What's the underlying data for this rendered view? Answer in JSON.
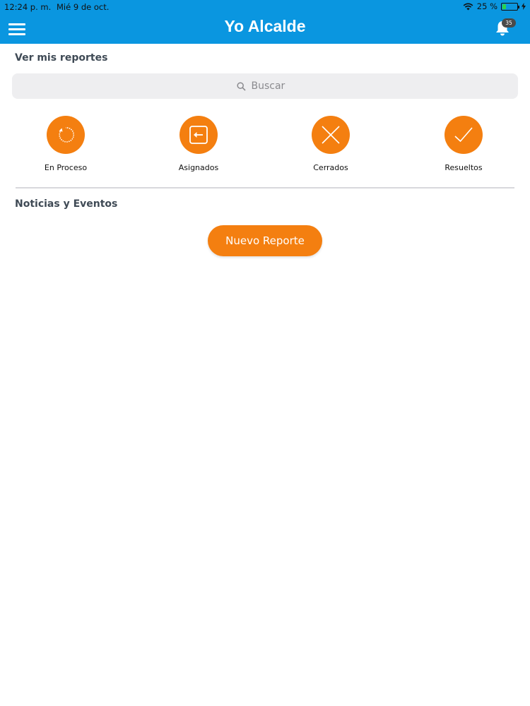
{
  "status_bar": {
    "time": "12:24 p. m.",
    "date": "Mié 9 de oct.",
    "battery_percent": "25 %",
    "battery_level": 0.25,
    "icons": [
      "wifi-icon",
      "battery-icon",
      "charging-icon"
    ]
  },
  "header": {
    "title": "Yo Alcalde",
    "menu_icon": "hamburger-icon",
    "notification_icon": "bell-icon",
    "notification_count": "35"
  },
  "reports": {
    "title": "Ver mis reportes",
    "search_placeholder": "Buscar",
    "categories": [
      {
        "label": "En Proceso",
        "icon": "refresh-icon"
      },
      {
        "label": "Asignados",
        "icon": "assigned-arrow-icon"
      },
      {
        "label": "Cerrados",
        "icon": "close-x-icon"
      },
      {
        "label": "Resueltos",
        "icon": "checkmark-icon"
      }
    ]
  },
  "news": {
    "title": "Noticias y Eventos"
  },
  "actions": {
    "new_report_label": "Nuevo Reporte"
  },
  "colors": {
    "header_bg": "#0a96e0",
    "accent_orange": "#f47f10",
    "search_bg": "#eeeef0",
    "title_text": "#3f4a55"
  }
}
